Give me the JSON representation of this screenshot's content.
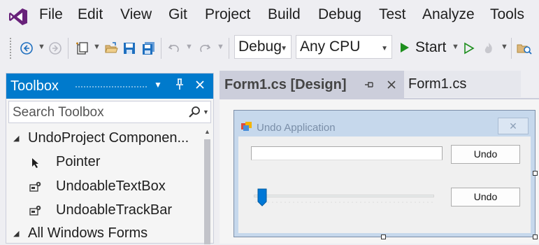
{
  "menu": {
    "items": [
      "File",
      "Edit",
      "View",
      "Git",
      "Project",
      "Build",
      "Debug",
      "Test",
      "Analyze",
      "Tools"
    ]
  },
  "toolbar": {
    "configuration": "Debug",
    "platform": "Any CPU",
    "start_label": "Start"
  },
  "toolbox": {
    "title": "Toolbox",
    "search_placeholder": "Search Toolbox",
    "groups": [
      {
        "label": "UndoProject Componen...",
        "items": [
          "Pointer",
          "UndoableTextBox",
          "UndoableTrackBar"
        ]
      },
      {
        "label": "All Windows Forms",
        "items": []
      }
    ]
  },
  "tabs": [
    {
      "label": "Form1.cs [Design]",
      "active": true
    },
    {
      "label": "Form1.cs",
      "active": false
    }
  ],
  "form": {
    "title": "Undo Application",
    "undo_button_1": "Undo",
    "undo_button_2": "Undo",
    "trackbar_value_fraction": 0.02
  },
  "colors": {
    "accent": "#007acc",
    "vs_logo": "#68217a",
    "start_green": "#1e8f1e",
    "form_frame": "#c6d8ec"
  },
  "icons": {
    "logo": "visual-studio-logo-icon",
    "navigate_back": "navigate-back-icon",
    "navigate_forward": "navigate-forward-icon",
    "new_project": "new-project-icon",
    "open_folder": "open-folder-icon",
    "save": "save-icon",
    "save_all": "save-all-icon",
    "undo": "undo-icon",
    "redo": "redo-icon",
    "start": "play-icon",
    "start_without_debugging": "play-outline-icon",
    "hot_reload": "hot-reload-icon",
    "solution_explorer": "folder-search-icon",
    "search": "search-icon",
    "pin": "pin-icon",
    "close": "close-icon"
  }
}
